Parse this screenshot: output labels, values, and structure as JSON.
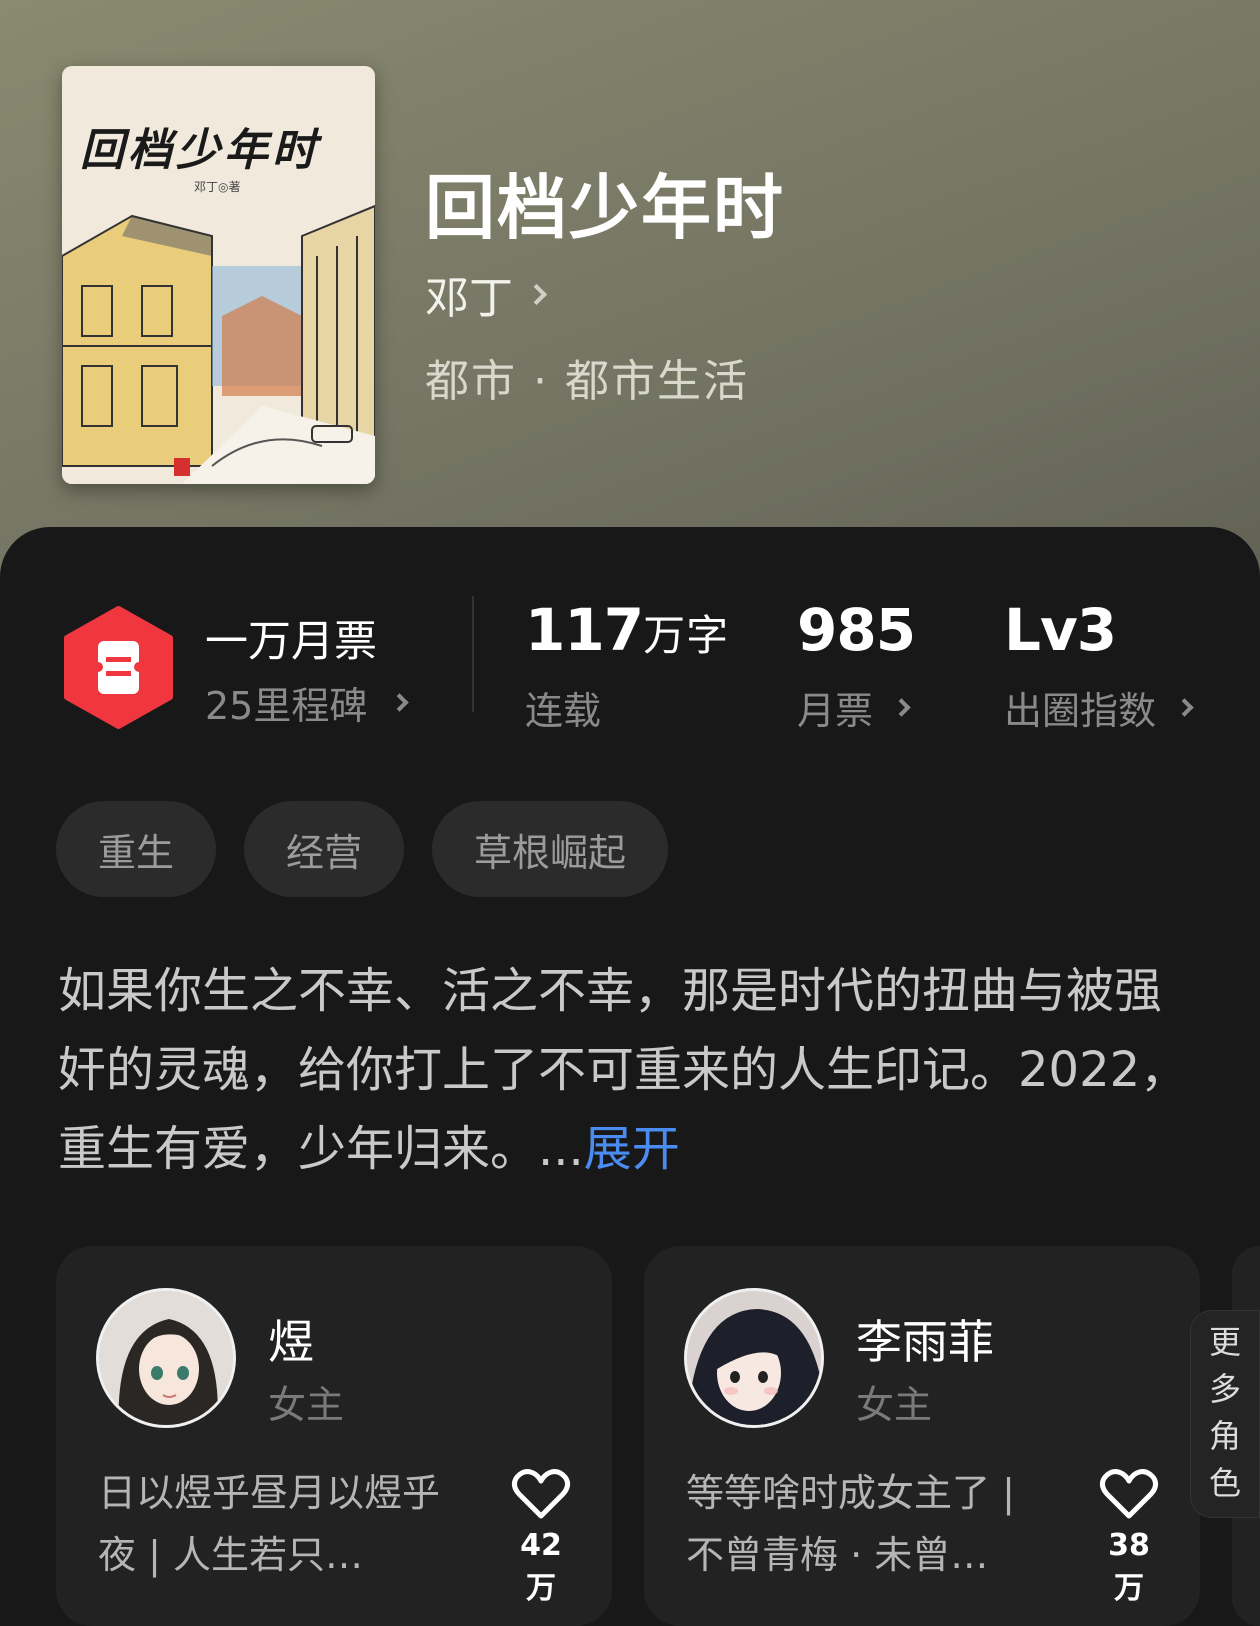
{
  "book": {
    "title": "回档少年时",
    "author": "邓丁",
    "genre": "都市 · 都市生活",
    "cover": {
      "title": "回档少年时",
      "author_line": "邓丁◎著"
    }
  },
  "stats": {
    "milestone_main": "一万月票",
    "milestone_sub": "25里程碑",
    "words_value": "117",
    "words_unit": "万字",
    "words_label": "连载",
    "tickets_value": "985",
    "tickets_label": "月票",
    "level_value": "Lv3",
    "level_label": "出圈指数"
  },
  "tags": [
    "重生",
    "经营",
    "草根崛起"
  ],
  "synopsis": {
    "text": "如果你生之不幸、活之不幸，那是时代的扭曲与被强奸的灵魂，给你打上了不可重来的人生印记。2022，重生有爱，少年归来。...",
    "expand_label": "展开"
  },
  "characters": [
    {
      "name": "煜",
      "role": "女主",
      "desc": "日以煜乎昼月以煜乎夜 | 人生若只…",
      "likes": "42万"
    },
    {
      "name": "李雨菲",
      "role": "女主",
      "desc": "等等啥时成女主了 | 不曾青梅 · 未曾…",
      "likes": "38万"
    }
  ],
  "more_characters_label": "更多角色",
  "colors": {
    "accent_link": "#4a8cf0",
    "badge_red": "#f0363e",
    "panel_bg": "#181818"
  }
}
